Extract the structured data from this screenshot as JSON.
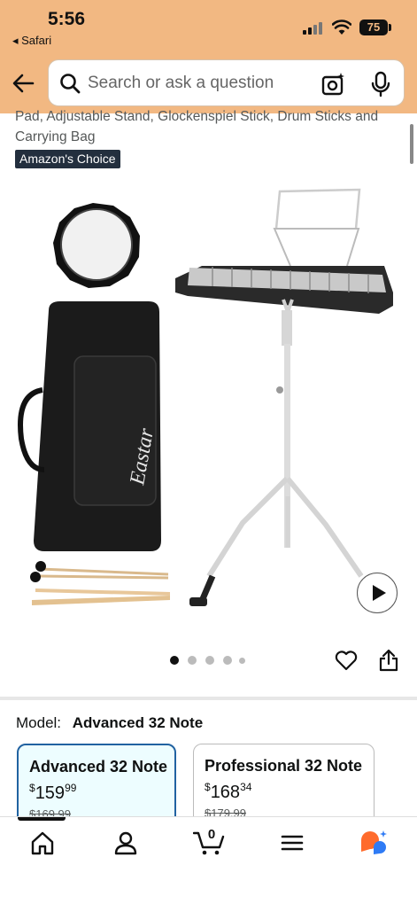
{
  "status_bar": {
    "time": "5:56",
    "back_app": "◂ Safari",
    "battery": "75"
  },
  "search": {
    "placeholder": "Search or ask a question"
  },
  "product": {
    "title": "Pad, Adjustable Stand, Glockenspiel Stick, Drum Sticks and Carrying Bag",
    "badge": "Amazon's Choice",
    "brand_on_bag": "Eastar",
    "image_count": 5,
    "current_image_index": 0
  },
  "model": {
    "label": "Model:",
    "selected": "Advanced 32 Note",
    "options": [
      {
        "name": "Advanced 32 Note",
        "currency": "$",
        "whole": "159",
        "cents": "99",
        "list_price": "$169.99"
      },
      {
        "name": "Professional 32 Note",
        "currency": "$",
        "whole": "168",
        "cents": "34",
        "list_price": "$179.99"
      }
    ]
  },
  "bottom_nav": {
    "cart_count": "0",
    "items": [
      "home-icon",
      "account-icon",
      "cart-icon",
      "menu-icon",
      "rufus-assistant-icon"
    ]
  },
  "colors": {
    "header_bg": "#f2b882",
    "badge_bg": "#232f3e",
    "selected_border": "#2162a1",
    "selected_bg": "#edfdff",
    "assistant_orange": "#ff6b2c",
    "assistant_blue": "#2f7bf5"
  }
}
